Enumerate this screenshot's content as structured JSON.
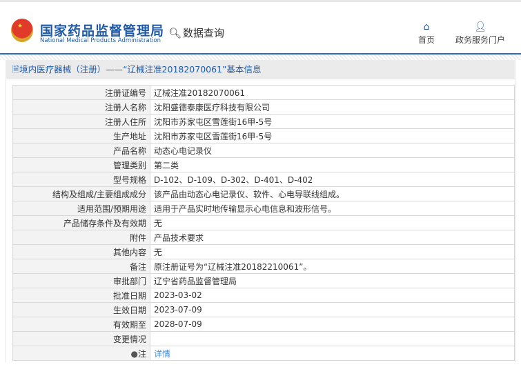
{
  "header": {
    "logo_cn": "国家药品监督管理局",
    "logo_en": "National Medical Products Administration",
    "query": "数据查询",
    "nav": [
      {
        "label": "首页",
        "icon": "home-icon"
      },
      {
        "label": "政务服务门户",
        "icon": "user-icon"
      }
    ]
  },
  "title": "境内医疗器械（注册）——“辽械注准20182070061”基本信息",
  "rows": [
    {
      "label": "注册证编号",
      "value": "辽械注准20182070061"
    },
    {
      "label": "注册人名称",
      "value": "沈阳盛德泰康医疗科技有限公司"
    },
    {
      "label": "注册人住所",
      "value": "沈阳市苏家屯区雪莲街16甲-5号"
    },
    {
      "label": "生产地址",
      "value": "沈阳市苏家屯区雪莲街16甲-5号"
    },
    {
      "label": "产品名称",
      "value": "动态心电记录仪"
    },
    {
      "label": "管理类别",
      "value": "第二类"
    },
    {
      "label": "型号规格",
      "value": "D-102、D-109、D-302、D-401、D-402"
    },
    {
      "label": "结构及组成/主要组成成分",
      "value": "该产品由动态心电记录仪、软件、心电导联线组成。"
    },
    {
      "label": "适用范围/预期用途",
      "value": "适用于产品实时地传输显示心电信息和波形信号。"
    },
    {
      "label": "产品储存条件及有效期",
      "value": "无"
    },
    {
      "label": "附件",
      "value": "产品技术要求"
    },
    {
      "label": "其他内容",
      "value": "无"
    },
    {
      "label": "备注",
      "value": "原注册证号为“辽械注准20182210061”。"
    },
    {
      "label": "审批部门",
      "value": "辽宁省药品监督管理局"
    },
    {
      "label": "批准日期",
      "value": "2023-03-02"
    },
    {
      "label": "生效日期",
      "value": "2023-07-09"
    },
    {
      "label": "有效期至",
      "value": "2028-07-09"
    },
    {
      "label": "变更情况",
      "value": ""
    }
  ],
  "note": {
    "label": "注",
    "link": "详情"
  }
}
